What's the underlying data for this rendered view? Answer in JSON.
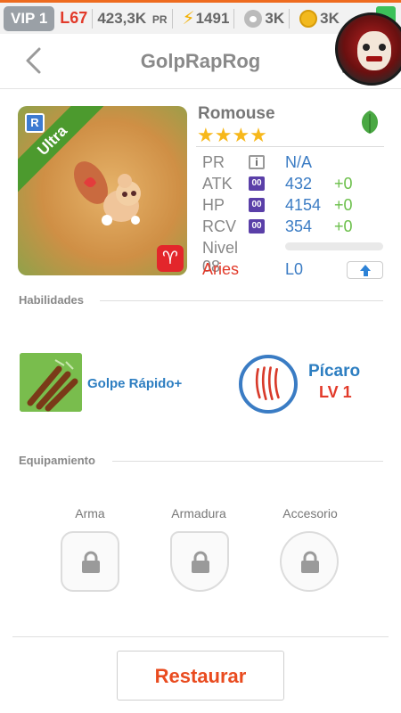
{
  "status": {
    "vip": "VIP 1",
    "level": "L67",
    "power_value": "423,3K",
    "power_unit": "PR",
    "energy": "1491",
    "paws": "3K",
    "coins": "3K"
  },
  "header": {
    "title": "GolpRapRog"
  },
  "monster": {
    "name": "Romouse",
    "stars": "★★★★",
    "rarity_label": "Ultra",
    "rarity_icon": "R",
    "element_icon": "leaf-icon",
    "sign_glyph": "♈",
    "stats": {
      "pr_label": "PR",
      "pr_icon": "i",
      "pr_value": "N/A",
      "atk_label": "ATK",
      "atk_icon": "00",
      "atk_value": "432",
      "atk_bonus": "+0",
      "hp_label": "HP",
      "hp_icon": "00",
      "hp_value": "4154",
      "hp_bonus": "+0",
      "rcv_label": "RCV",
      "rcv_icon": "00",
      "rcv_value": "354",
      "rcv_bonus": "+0",
      "level_label": "Nivel 08",
      "level_progress": 0,
      "sign_label": "Aries",
      "sign_level": "L0"
    }
  },
  "abilities": {
    "heading": "Habilidades",
    "active_skill": "Golpe Rápido+",
    "passive_skill": "Pícaro",
    "passive_level": "LV 1"
  },
  "equipment": {
    "heading": "Equipamiento",
    "weapon": "Arma",
    "armor": "Armadura",
    "accessory": "Accesorio"
  },
  "actions": {
    "restore": "Restaurar"
  },
  "colors": {
    "accent_blue": "#3b7cc4",
    "accent_red": "#e23a2a",
    "accent_green": "#6bbf4a",
    "star_gold": "#f7b81b"
  }
}
